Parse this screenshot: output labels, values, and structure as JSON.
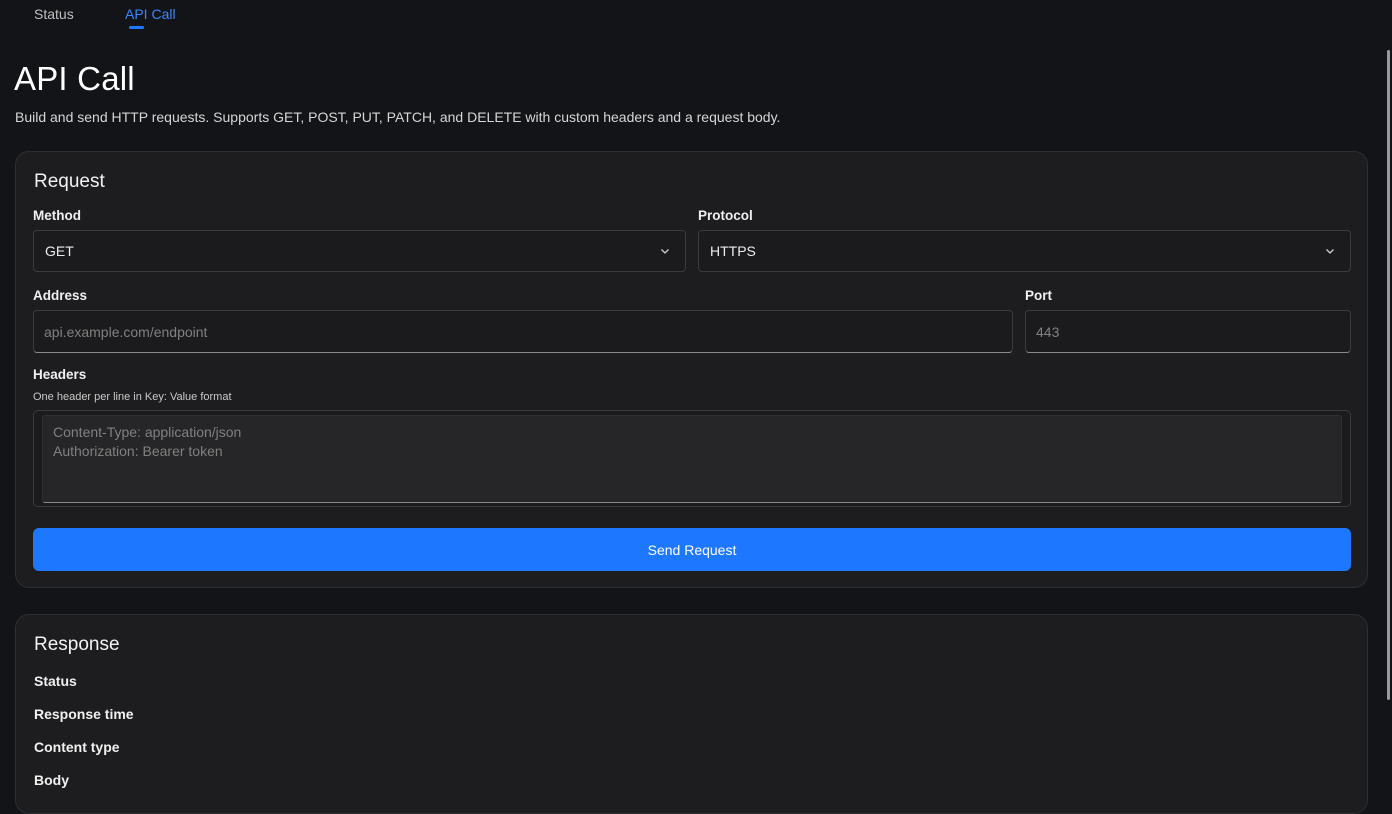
{
  "tabs": [
    {
      "label": "Status",
      "active": false
    },
    {
      "label": "API Call",
      "active": true
    }
  ],
  "page": {
    "title": "API Call",
    "subtitle": "Build and send HTTP requests. Supports GET, POST, PUT, PATCH, and DELETE with custom headers and a request body."
  },
  "request": {
    "title": "Request",
    "method": {
      "label": "Method",
      "value": "GET"
    },
    "protocol": {
      "label": "Protocol",
      "value": "HTTPS"
    },
    "address": {
      "label": "Address",
      "placeholder": "api.example.com/endpoint",
      "value": ""
    },
    "port": {
      "label": "Port",
      "placeholder": "443",
      "value": ""
    },
    "headers": {
      "label": "Headers",
      "hint": "One header per line in Key: Value format",
      "placeholder": "Content-Type: application/json\nAuthorization: Bearer token",
      "value": ""
    },
    "send_label": "Send Request"
  },
  "response": {
    "title": "Response",
    "fields": [
      "Status",
      "Response time",
      "Content type",
      "Body"
    ]
  },
  "colors": {
    "accent": "#1e78ff",
    "background": "#131417",
    "card": "#1d1d1f"
  }
}
